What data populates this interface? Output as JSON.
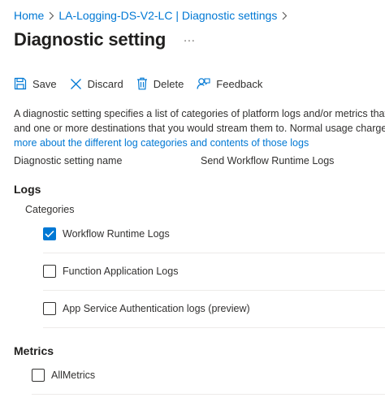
{
  "breadcrumb": {
    "items": [
      "Home",
      "LA-Logging-DS-V2-LC | Diagnostic settings"
    ]
  },
  "header": {
    "title": "Diagnostic setting",
    "more": "..."
  },
  "toolbar": {
    "save": "Save",
    "discard": "Discard",
    "delete": "Delete",
    "feedback": "Feedback"
  },
  "description": {
    "line1": "A diagnostic setting specifies a list of categories of platform logs and/or metrics that yo",
    "line2": "and one or more destinations that you would stream them to. Normal usage charges fo",
    "link": "more about the different log categories and contents of those logs"
  },
  "setting_name": {
    "label": "Diagnostic setting name",
    "value": "Send Workflow Runtime Logs"
  },
  "logs": {
    "title": "Logs",
    "categories_label": "Categories",
    "items": [
      {
        "label": "Workflow Runtime Logs",
        "checked": true
      },
      {
        "label": "Function Application Logs",
        "checked": false
      },
      {
        "label": "App Service Authentication logs (preview)",
        "checked": false
      }
    ]
  },
  "metrics": {
    "title": "Metrics",
    "items": [
      {
        "label": "AllMetrics",
        "checked": false
      }
    ]
  },
  "colors": {
    "accent": "#0078d4",
    "text": "#323130",
    "divider": "#edebe9"
  }
}
